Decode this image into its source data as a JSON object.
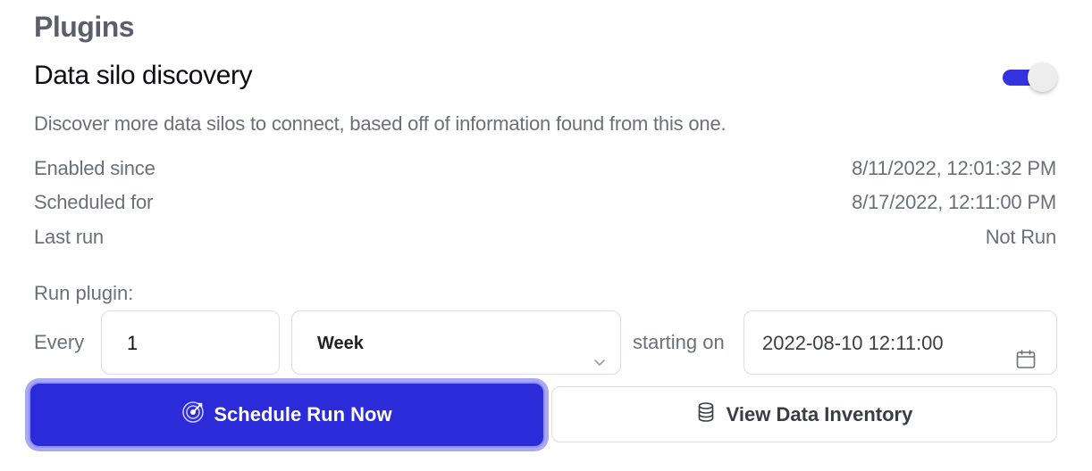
{
  "section_title": "Plugins",
  "plugin": {
    "name": "Data silo discovery",
    "enabled": true,
    "description": "Discover more data silos to connect, based off of information found from this one."
  },
  "details": [
    {
      "label": "Enabled since",
      "value": "8/11/2022, 12:01:32 PM"
    },
    {
      "label": "Scheduled for",
      "value": "8/17/2022, 12:11:00 PM"
    },
    {
      "label": "Last run",
      "value": "Not Run"
    }
  ],
  "schedule": {
    "run_label": "Run plugin:",
    "every_label": "Every",
    "interval_value": "1",
    "unit_selected": "Week",
    "starting_label": "starting on",
    "start_datetime": "2022-08-10 12:11:00"
  },
  "buttons": {
    "schedule_run_now": "Schedule Run Now",
    "view_data_inventory": "View Data Inventory"
  },
  "icons": {
    "toggle": "toggle-switch",
    "select": "chevron-down-icon",
    "date": "calendar-icon",
    "schedule": "target-icon",
    "inventory": "database-icon"
  },
  "colors": {
    "accent": "#2b2bd9",
    "toggle_on": "#3333e0",
    "muted_text": "#6b6f7a"
  }
}
